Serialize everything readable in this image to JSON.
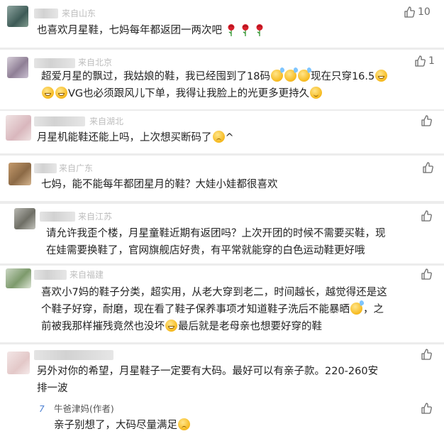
{
  "comments": [
    {
      "location": "来自山东",
      "likes": "10",
      "lines": [
        "也喜欢月星鞋，七妈每年都返团一两次吧"
      ],
      "emoji_after": "rose x3"
    },
    {
      "location": "来自北京",
      "likes": "1",
      "line1": "超爱月星的飘过，我姑娘的鞋，我已经囤到了18码",
      "line1b": "现在只穿16.5",
      "line2": "VG也必须跟风儿下单，我得让我脸上的光更多更持久"
    },
    {
      "location": "来自湖北",
      "likes": "",
      "line1": "月星机能鞋还能上吗，上次想买断码了",
      "line1b": "^"
    },
    {
      "location": "来自广东",
      "likes": "",
      "line1": "七妈，能不能每年都团星月的鞋？大娃小娃都很喜欢"
    },
    {
      "location": "来自江苏",
      "likes": "",
      "line1": "请允许我歪个楼，月星童鞋近期有返团吗？上次开团的时候不需要买鞋，现",
      "line2": "在娃需要换鞋了，官网旗舰店好贵，有平常就能穿的白色运动鞋更好哦"
    },
    {
      "location": "来自福建",
      "likes": "",
      "line1": "喜欢小7妈的鞋子分类，超实用，从老大穿到老二，时间越长，越觉得还是这",
      "line2": "个鞋子好穿，耐磨，现在看了鞋子保养事项才知道鞋子洗后不能暴晒",
      "line2b": "，之",
      "line3": "前被我那样摧残竟然也没坏",
      "line3b": "最后就是老母亲也想要好穿的鞋"
    },
    {
      "location": "",
      "likes": "",
      "line1": "另外对你的希望，月星鞋子一定要有大码。最好可以有亲子款。220-260安",
      "line2": "排一波"
    }
  ],
  "reply": {
    "author": "牛爸津妈(作者)",
    "avatar_glyph": "7",
    "text": "亲子别想了，大码尽量满足",
    "likes": ""
  },
  "colors": {
    "background": "#ececec",
    "card": "#ffffff",
    "location": "#bdbdbd",
    "text": "#222222"
  },
  "icons": {
    "like": "thumbs-up-icon"
  }
}
